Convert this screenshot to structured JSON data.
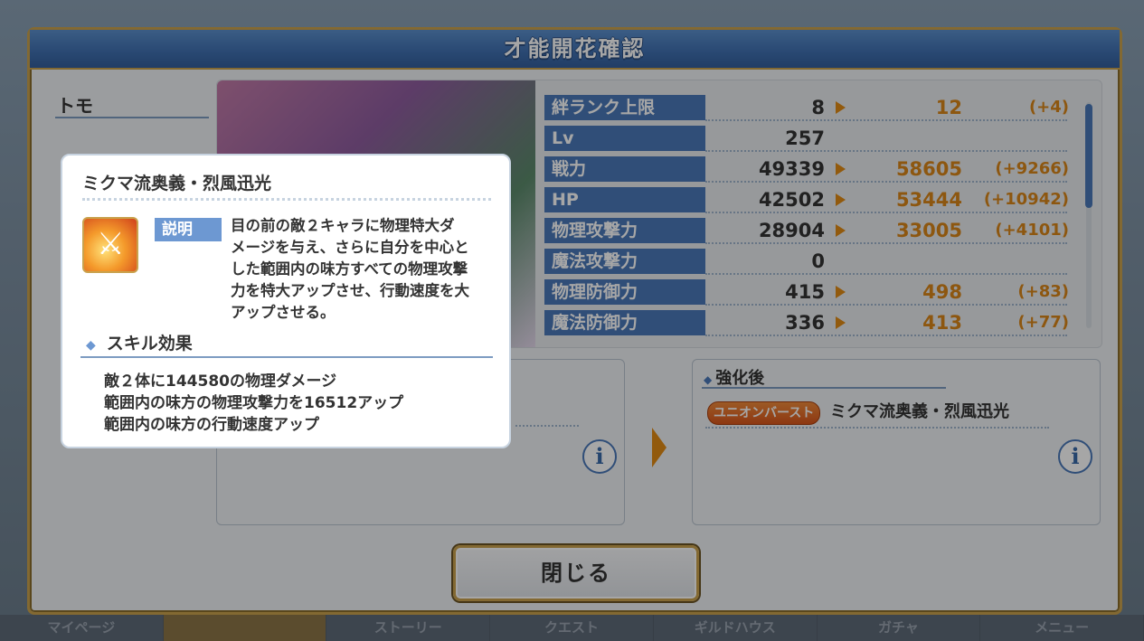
{
  "window": {
    "title": "才能開花確認"
  },
  "character": {
    "name": "トモ"
  },
  "stats": [
    {
      "label": "絆ランク上限",
      "value": "8",
      "new": "12",
      "diff": "(+4)"
    },
    {
      "label": "Lv",
      "value": "257",
      "new": "",
      "diff": ""
    },
    {
      "label": "戦力",
      "value": "49339",
      "new": "58605",
      "diff": "(+9266)"
    },
    {
      "label": "HP",
      "value": "42502",
      "new": "53444",
      "diff": "(+10942)"
    },
    {
      "label": "物理攻撃力",
      "value": "28904",
      "new": "33005",
      "diff": "(+4101)"
    },
    {
      "label": "魔法攻撃力",
      "value": "0",
      "new": "",
      "diff": ""
    },
    {
      "label": "物理防御力",
      "value": "415",
      "new": "498",
      "diff": "(+83)"
    },
    {
      "label": "魔法防御力",
      "value": "336",
      "new": "413",
      "diff": "(+77)"
    }
  ],
  "after": {
    "title": "強化後",
    "badge": "ユニオンバースト",
    "skill_name": "ミクマ流奥義・烈風迅光",
    "info": "i"
  },
  "before": {
    "info": "i"
  },
  "close_label": "閉じる",
  "popup": {
    "title": "ミクマ流奥義・烈風迅光",
    "desc_tag": "説明",
    "desc_lines": [
      "目の前の敵２キャラに物理特大ダ",
      "メージを与え、さらに自分を中心と",
      "した範囲内の味方すべての物理攻撃",
      "力を特大アップさせ、行動速度を大",
      "アップさせる。"
    ],
    "effect_title": "スキル効果",
    "effects": [
      "敵２体に144580の物理ダメージ",
      "範囲内の味方の物理攻撃力を16512アップ",
      "範囲内の味方の行動速度アップ"
    ]
  },
  "bottom_nav": [
    "マイページ",
    "",
    "ストーリー",
    "クエスト",
    "ギルドハウス",
    "ガチャ",
    "メニュー"
  ],
  "colors": {
    "accent": "#4a79b9",
    "orange": "#d9861a",
    "gold": "#c9a24d"
  }
}
